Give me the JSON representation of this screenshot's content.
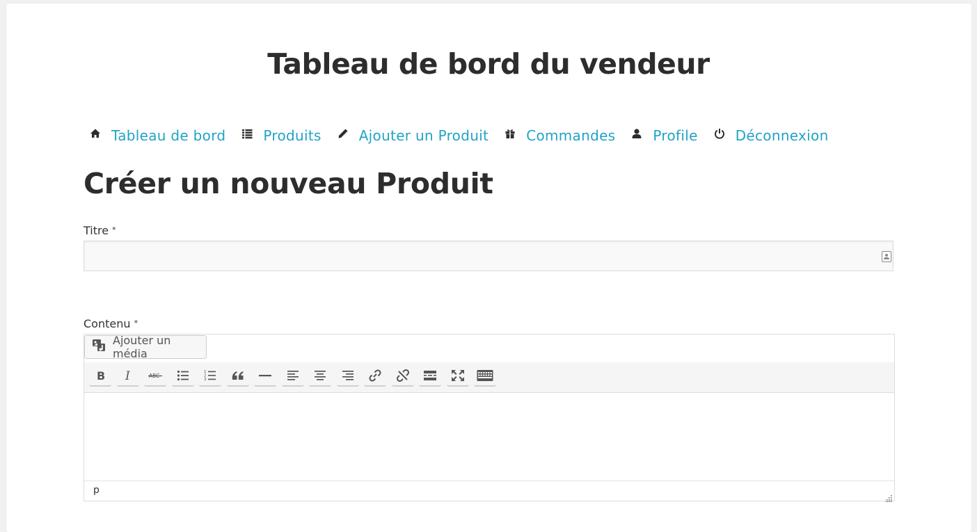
{
  "header": {
    "title": "Tableau de bord du vendeur"
  },
  "nav": {
    "items": [
      {
        "label": "Tableau de bord",
        "icon": "home-icon"
      },
      {
        "label": "Produits",
        "icon": "list-icon"
      },
      {
        "label": "Ajouter un Produit",
        "icon": "pencil-icon"
      },
      {
        "label": "Commandes",
        "icon": "gift-icon"
      },
      {
        "label": "Profile",
        "icon": "user-icon"
      },
      {
        "label": "Déconnexion",
        "icon": "power-icon"
      }
    ],
    "link_color": "#21a3c6"
  },
  "form": {
    "heading": "Créer un nouveau Produit",
    "title_label": "Titre",
    "title_required": "*",
    "title_value": "",
    "content_label": "Contenu",
    "content_required": "*",
    "media_button": "Ajouter un média",
    "toolbar": [
      {
        "name": "bold",
        "icon": "bold-icon"
      },
      {
        "name": "italic",
        "icon": "italic-icon"
      },
      {
        "name": "strikethrough",
        "icon": "strikethrough-icon"
      },
      {
        "name": "bullet-list",
        "icon": "bullet-list-icon"
      },
      {
        "name": "numbered-list",
        "icon": "numbered-list-icon"
      },
      {
        "name": "blockquote",
        "icon": "blockquote-icon"
      },
      {
        "name": "horizontal-rule",
        "icon": "horizontal-rule-icon"
      },
      {
        "name": "align-left",
        "icon": "align-left-icon"
      },
      {
        "name": "align-center",
        "icon": "align-center-icon"
      },
      {
        "name": "align-right",
        "icon": "align-right-icon"
      },
      {
        "name": "link",
        "icon": "link-icon"
      },
      {
        "name": "unlink",
        "icon": "unlink-icon"
      },
      {
        "name": "read-more",
        "icon": "read-more-icon"
      },
      {
        "name": "fullscreen",
        "icon": "fullscreen-icon"
      },
      {
        "name": "toolbar-toggle",
        "icon": "keyboard-icon"
      }
    ],
    "status_path": "p"
  }
}
